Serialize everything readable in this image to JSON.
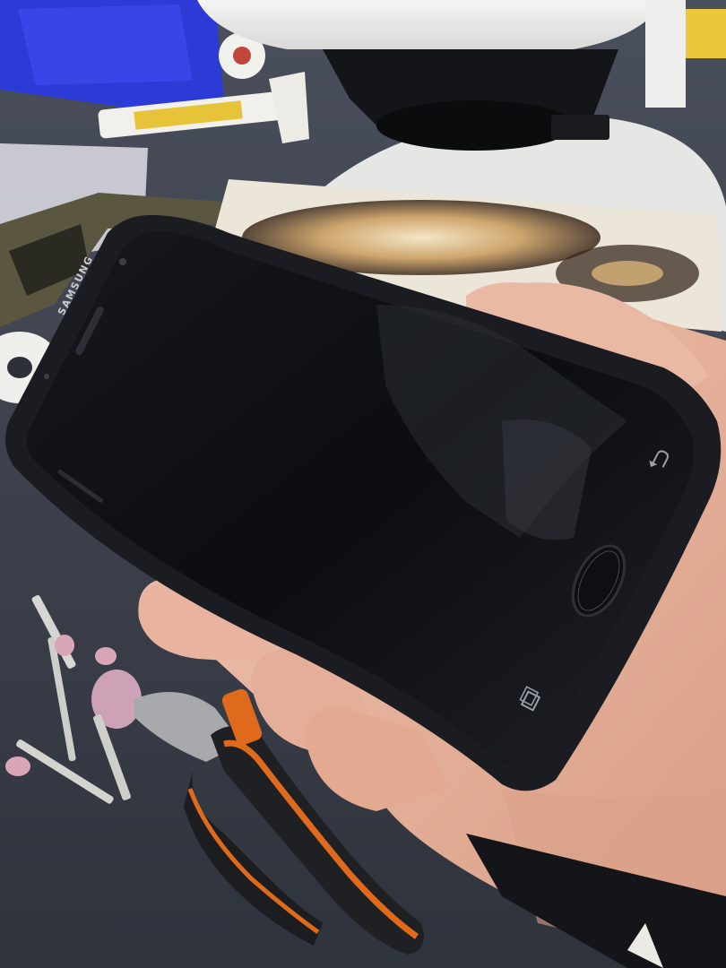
{
  "phone": {
    "brand_label": "SAMSUNG",
    "screen_state": "off"
  },
  "icons": {
    "back": "back-arrow-icon",
    "home": "home-button-icon",
    "recents": "recent-apps-icon"
  },
  "colors": {
    "workbench": "#3a3f4a",
    "phone_body": "#15171b",
    "screen": "#0f1114",
    "burnt_pad": "#e8e2d6",
    "plier_orange": "#e06a1c",
    "grinding_bit": "#d8a6b6",
    "skin": "#e7b7a1"
  }
}
